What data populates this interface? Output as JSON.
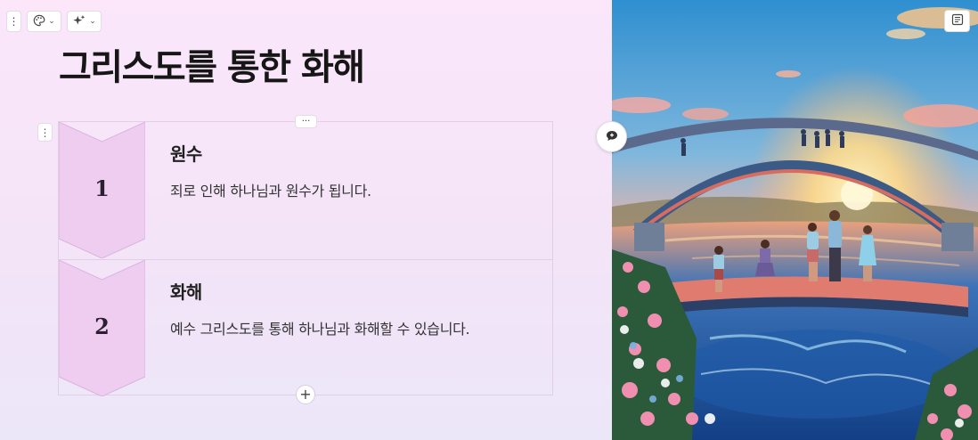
{
  "slide": {
    "title": "그리스도를 통한 화해",
    "steps": [
      {
        "number": "1",
        "title": "원수",
        "description": "죄로 인해 하나님과 원수가 됩니다."
      },
      {
        "number": "2",
        "title": "화해",
        "description": "예수 그리스도를 통해 하나님과 화해할 수 있습니다."
      }
    ]
  },
  "toolbar": {
    "handle_icon": "vertical-dots-icon",
    "theme_icon": "palette-icon",
    "ai_icon": "sparkle-icon",
    "dropdown_glyph": "⌄"
  },
  "controls": {
    "more_label": "···",
    "add_label": "+",
    "comment_icon": "comment-icon",
    "notes_icon": "notes-icon"
  },
  "colors": {
    "background_top": "#fbe6fa",
    "background_bottom": "#ece6f9",
    "chevron_fill": "#efcdf1",
    "chevron_stroke": "#d9b3de",
    "card_border": "#e2cfe6",
    "title_text": "#161616"
  }
}
